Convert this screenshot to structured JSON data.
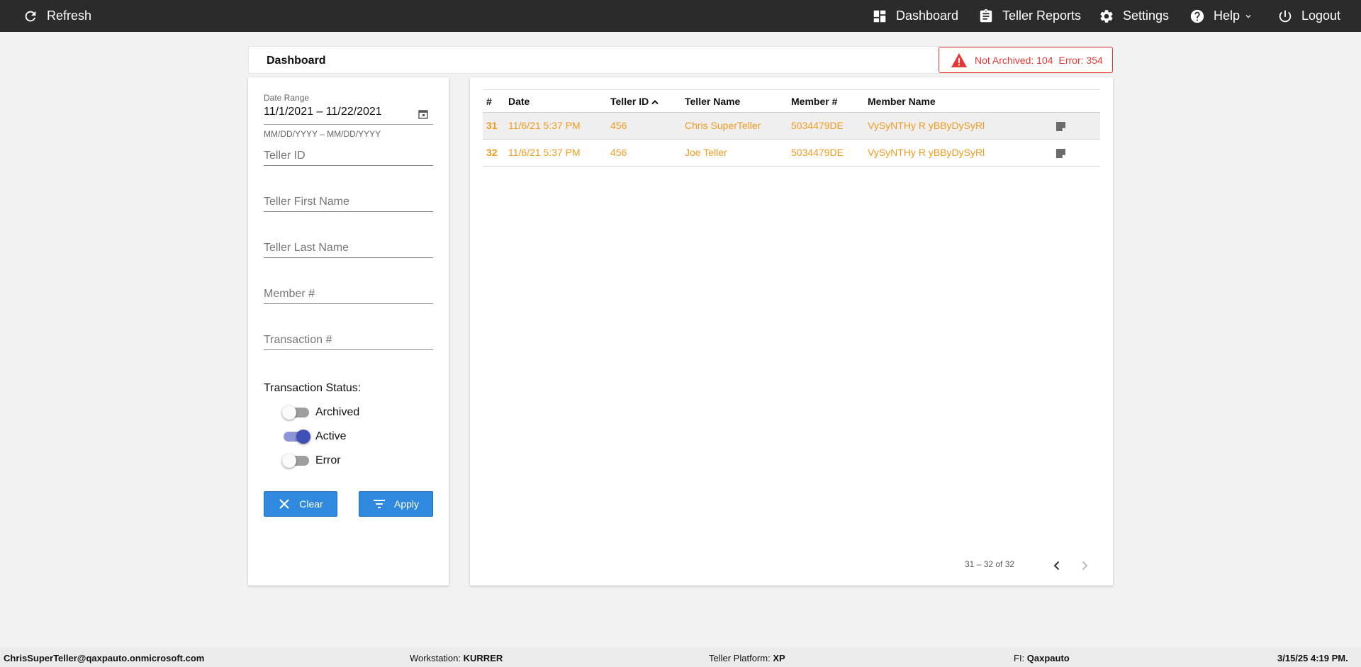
{
  "topbar": {
    "refresh": "Refresh",
    "dashboard": "Dashboard",
    "teller_reports": "Teller Reports",
    "settings": "Settings",
    "help": "Help",
    "logout": "Logout"
  },
  "header": {
    "title": "Dashboard",
    "alert": {
      "not_archived": "Not Archived: 104",
      "error": "Error: 354",
      "color": "#e53935"
    }
  },
  "filters": {
    "date_range_label": "Date Range",
    "date_range_value": "11/1/2021 – 11/22/2021",
    "date_hint": "MM/DD/YYYY – MM/DD/YYYY",
    "teller_id_placeholder": "Teller ID",
    "teller_first_name_placeholder": "Teller First Name",
    "teller_last_name_placeholder": "Teller Last Name",
    "member_placeholder": "Member #",
    "transaction_placeholder": "Transaction #",
    "status_label": "Transaction Status:",
    "statuses": [
      {
        "label": "Archived",
        "on": false
      },
      {
        "label": "Active",
        "on": true
      },
      {
        "label": "Error",
        "on": false
      }
    ],
    "clear_label": "Clear",
    "apply_label": "Apply",
    "button_color": "#2f89df"
  },
  "table": {
    "columns": [
      "#",
      "Date",
      "Teller ID",
      "Teller Name",
      "Member #",
      "Member Name"
    ],
    "sort_column": "Teller ID",
    "rows": [
      {
        "num": "31",
        "date": "11/6/21 5:37 PM",
        "teller_id": "456",
        "teller_name": "Chris SuperTeller",
        "member_num": "5034479DE",
        "member_name": "VySyNTHy R yBByDySyRl"
      },
      {
        "num": "32",
        "date": "11/6/21 5:37 PM",
        "teller_id": "456",
        "teller_name": "Joe Teller",
        "member_num": "5034479DE",
        "member_name": "VySyNTHy R yBByDySyRl"
      }
    ],
    "row_text_color": "#f29a1e",
    "pagination": "31 – 32 of 32"
  },
  "footer": {
    "user": "ChrisSuperTeller@qaxpauto.onmicrosoft.com",
    "workstation_label": "Workstation:",
    "workstation": "KURRER",
    "platform_label": "Teller Platform:",
    "platform": "XP",
    "fi_label": "FI:",
    "fi": "Qaxpauto",
    "datetime": "3/15/25 4:19 PM."
  }
}
